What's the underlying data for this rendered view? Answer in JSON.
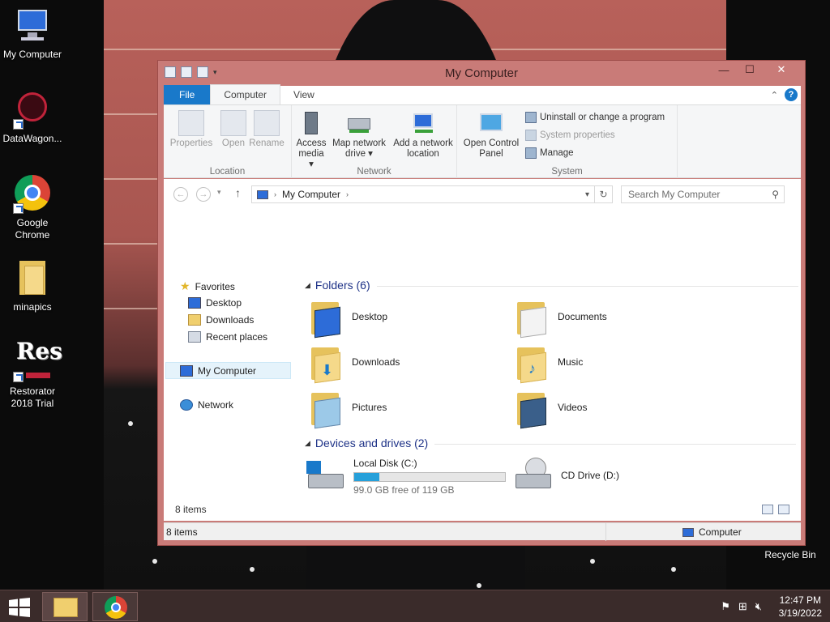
{
  "desktop": {
    "icons": [
      {
        "label": "My Computer"
      },
      {
        "label": "DataWagon..."
      },
      {
        "label": "Google Chrome"
      },
      {
        "label": "minapics"
      },
      {
        "label": "Restorator 2018 Trial"
      }
    ],
    "recycle_bin": "Recycle Bin"
  },
  "window": {
    "title": "My Computer",
    "tabs": [
      "File",
      "Computer",
      "View"
    ],
    "ribbon": {
      "location": {
        "label": "Location",
        "buttons": [
          "Properties",
          "Open",
          "Rename"
        ]
      },
      "network": {
        "label": "Network",
        "access_media": "Access media",
        "map_drive": "Map network drive",
        "add_location": "Add a network location"
      },
      "system": {
        "label": "System",
        "control_panel": "Open Control Panel",
        "uninstall": "Uninstall or change a program",
        "system_properties": "System properties",
        "manage": "Manage"
      }
    },
    "address": {
      "path": "My Computer",
      "search_placeholder": "Search My Computer"
    },
    "nav": {
      "favorites": "Favorites",
      "items": [
        "Desktop",
        "Downloads",
        "Recent places"
      ],
      "my_computer": "My Computer",
      "network": "Network"
    },
    "folders_header": "Folders (6)",
    "folders": [
      "Desktop",
      "Documents",
      "Downloads",
      "Music",
      "Pictures",
      "Videos"
    ],
    "devices_header": "Devices and drives (2)",
    "drives": [
      {
        "name": "Local Disk (C:)",
        "free": "99.0 GB free of 119 GB",
        "used_fraction": 0.168
      },
      {
        "name": "CD Drive (D:)"
      }
    ],
    "item_count": "8 items",
    "status_left": "8 items",
    "status_right": "Computer"
  },
  "taskbar": {
    "time": "12:47 PM",
    "date": "3/19/2022"
  },
  "colors": {
    "accent": "#1979ca",
    "window_frame": "#c97b78",
    "progress": "#26a0da"
  }
}
